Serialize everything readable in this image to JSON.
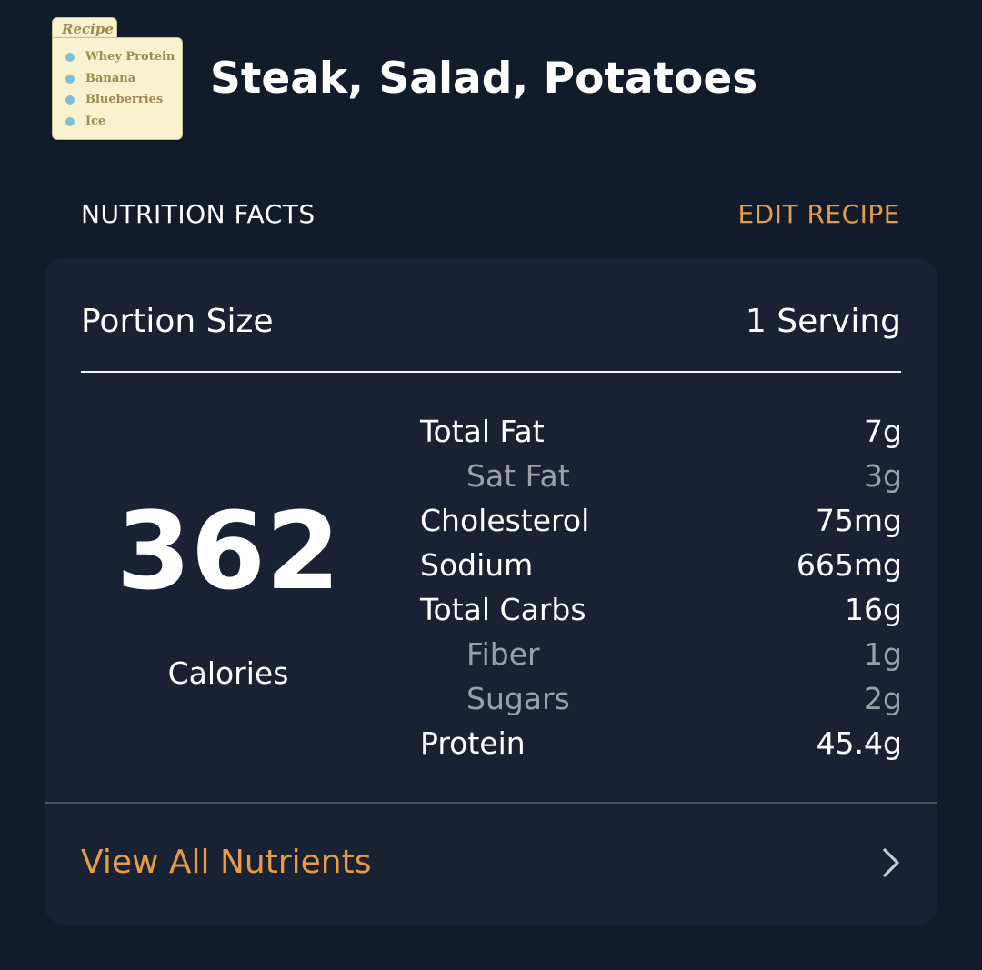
{
  "recipe_icon": {
    "tab_label": "Recipe",
    "items": [
      "Whey Protein",
      "Banana",
      "Blueberries",
      "Ice"
    ]
  },
  "header": {
    "title": "Steak, Salad, Potatoes"
  },
  "section": {
    "label": "NUTRITION FACTS",
    "edit_label": "EDIT RECIPE"
  },
  "portion": {
    "label": "Portion Size",
    "value": "1 Serving"
  },
  "calories": {
    "value": "362",
    "label": "Calories"
  },
  "nutrients": [
    {
      "name": "Total Fat",
      "value": "7g",
      "sub": false
    },
    {
      "name": "Sat Fat",
      "value": "3g",
      "sub": true
    },
    {
      "name": "Cholesterol",
      "value": "75mg",
      "sub": false
    },
    {
      "name": "Sodium",
      "value": "665mg",
      "sub": false
    },
    {
      "name": "Total Carbs",
      "value": "16g",
      "sub": false
    },
    {
      "name": "Fiber",
      "value": "1g",
      "sub": true
    },
    {
      "name": "Sugars",
      "value": "2g",
      "sub": true
    },
    {
      "name": "Protein",
      "value": "45.4g",
      "sub": false
    }
  ],
  "footer": {
    "view_all_label": "View All Nutrients",
    "chevron_icon": "chevron-right-icon"
  },
  "colors": {
    "background": "#121b29",
    "card": "#182232",
    "accent": "#e89a45",
    "secondary_text": "#9aa0a8",
    "recipe_card": "#f8f2cf",
    "bullet": "#7ec0d6"
  }
}
